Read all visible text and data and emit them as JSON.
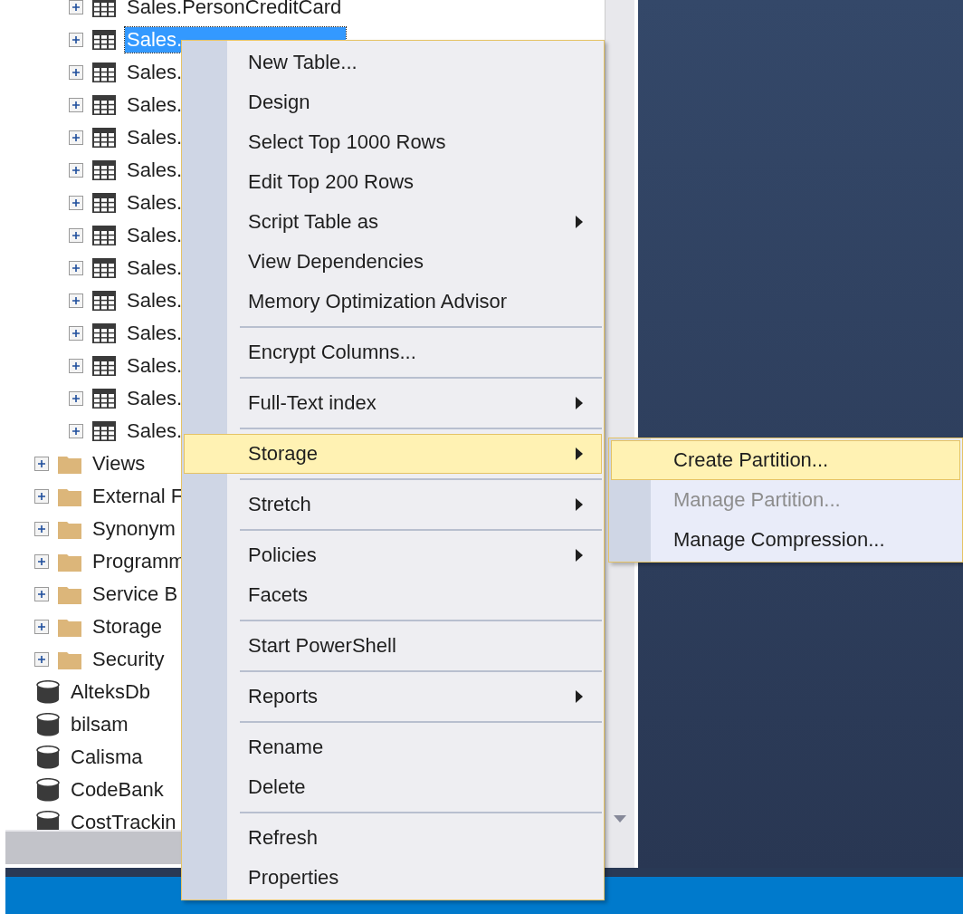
{
  "tree": [
    {
      "kind": "table",
      "label": "Sales.PersonCreditCard",
      "selected": false
    },
    {
      "kind": "table",
      "label": "Sales.",
      "selected": true
    },
    {
      "kind": "table",
      "label": "Sales.",
      "selected": false
    },
    {
      "kind": "table",
      "label": "Sales.",
      "selected": false
    },
    {
      "kind": "table",
      "label": "Sales.",
      "selected": false
    },
    {
      "kind": "table",
      "label": "Sales.",
      "selected": false
    },
    {
      "kind": "table",
      "label": "Sales.",
      "selected": false
    },
    {
      "kind": "table",
      "label": "Sales.",
      "selected": false
    },
    {
      "kind": "table",
      "label": "Sales.",
      "selected": false
    },
    {
      "kind": "table",
      "label": "Sales.",
      "selected": false
    },
    {
      "kind": "table",
      "label": "Sales.",
      "selected": false
    },
    {
      "kind": "table",
      "label": "Sales.",
      "selected": false
    },
    {
      "kind": "table",
      "label": "Sales.",
      "selected": false
    },
    {
      "kind": "table",
      "label": "Sales.",
      "selected": false
    },
    {
      "kind": "folder",
      "label": "Views",
      "selected": false
    },
    {
      "kind": "folder",
      "label": "External F",
      "selected": false
    },
    {
      "kind": "folder",
      "label": "Synonym",
      "selected": false
    },
    {
      "kind": "folder",
      "label": "Programm",
      "selected": false
    },
    {
      "kind": "folder",
      "label": "Service B",
      "selected": false
    },
    {
      "kind": "folder",
      "label": "Storage",
      "selected": false
    },
    {
      "kind": "folder",
      "label": "Security",
      "selected": false
    },
    {
      "kind": "database",
      "label": "AlteksDb",
      "selected": false
    },
    {
      "kind": "database",
      "label": "bilsam",
      "selected": false
    },
    {
      "kind": "database",
      "label": "Calisma",
      "selected": false
    },
    {
      "kind": "database",
      "label": "CodeBank",
      "selected": false
    },
    {
      "kind": "database",
      "label": "CostTrackin",
      "selected": false
    }
  ],
  "context_menu": [
    {
      "kind": "item",
      "label": "New Table...",
      "highlighted": false,
      "submenu": false
    },
    {
      "kind": "item",
      "label": "Design",
      "highlighted": false,
      "submenu": false
    },
    {
      "kind": "item",
      "label": "Select Top 1000 Rows",
      "highlighted": false,
      "submenu": false
    },
    {
      "kind": "item",
      "label": "Edit Top 200 Rows",
      "highlighted": false,
      "submenu": false
    },
    {
      "kind": "item",
      "label": "Script Table as",
      "highlighted": false,
      "submenu": true
    },
    {
      "kind": "item",
      "label": "View Dependencies",
      "highlighted": false,
      "submenu": false
    },
    {
      "kind": "item",
      "label": "Memory Optimization Advisor",
      "highlighted": false,
      "submenu": false
    },
    {
      "kind": "separator"
    },
    {
      "kind": "item",
      "label": "Encrypt Columns...",
      "highlighted": false,
      "submenu": false
    },
    {
      "kind": "separator"
    },
    {
      "kind": "item",
      "label": "Full-Text index",
      "highlighted": false,
      "submenu": true
    },
    {
      "kind": "separator"
    },
    {
      "kind": "item",
      "label": "Storage",
      "highlighted": true,
      "submenu": true
    },
    {
      "kind": "separator"
    },
    {
      "kind": "item",
      "label": "Stretch",
      "highlighted": false,
      "submenu": true
    },
    {
      "kind": "separator"
    },
    {
      "kind": "item",
      "label": "Policies",
      "highlighted": false,
      "submenu": true
    },
    {
      "kind": "item",
      "label": "Facets",
      "highlighted": false,
      "submenu": false
    },
    {
      "kind": "separator"
    },
    {
      "kind": "item",
      "label": "Start PowerShell",
      "highlighted": false,
      "submenu": false
    },
    {
      "kind": "separator"
    },
    {
      "kind": "item",
      "label": "Reports",
      "highlighted": false,
      "submenu": true
    },
    {
      "kind": "separator"
    },
    {
      "kind": "item",
      "label": "Rename",
      "highlighted": false,
      "submenu": false
    },
    {
      "kind": "item",
      "label": "Delete",
      "highlighted": false,
      "submenu": false
    },
    {
      "kind": "separator"
    },
    {
      "kind": "item",
      "label": "Refresh",
      "highlighted": false,
      "submenu": false
    },
    {
      "kind": "item",
      "label": "Properties",
      "highlighted": false,
      "submenu": false
    }
  ],
  "submenu": [
    {
      "label": "Create Partition...",
      "highlighted": true,
      "disabled": false
    },
    {
      "label": "Manage Partition...",
      "highlighted": false,
      "disabled": true
    },
    {
      "label": "Manage Compression...",
      "highlighted": false,
      "disabled": false
    }
  ]
}
